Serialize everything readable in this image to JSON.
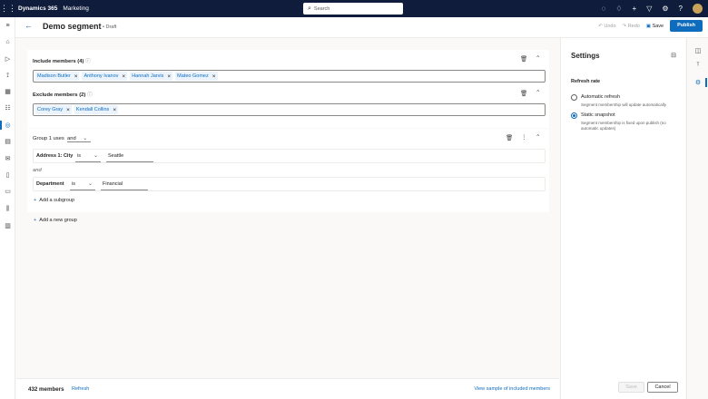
{
  "topbar": {
    "brand": "Dynamics 365",
    "app": "Marketing",
    "search_placeholder": "Search"
  },
  "header": {
    "title": "Demo segment",
    "status": "Draft",
    "undo_label": "Undo",
    "redo_label": "Redo",
    "save_label": "Save",
    "publish_label": "Publish"
  },
  "include": {
    "label": "Include members (4)",
    "members": [
      "Madison Butler",
      "Anthony Ivanov",
      "Hannah Jarvis",
      "Mateo Gomez"
    ]
  },
  "exclude": {
    "label": "Exclude members (2)",
    "members": [
      "Corey Gray",
      "Kendall Collins"
    ]
  },
  "group": {
    "label": "Group 1 uses",
    "operator": "and",
    "conditions": [
      {
        "attribute": "Address 1: City",
        "operator": "is",
        "value": "Seattle"
      },
      {
        "attribute": "Department",
        "operator": "is",
        "value": "Financial"
      }
    ],
    "joiner": "and",
    "add_subgroup_label": "Add a subgroup"
  },
  "add_group_label": "Add a new group",
  "footer": {
    "count": "432 members",
    "refresh_label": "Refresh",
    "sample_link": "View sample of included members"
  },
  "settings": {
    "title": "Settings",
    "refresh_rate_label": "Refresh rate",
    "options": [
      {
        "label": "Automatic refresh",
        "desc": "Segment membership will update automatically",
        "selected": false
      },
      {
        "label": "Static snapshot",
        "desc": "Segment membership is fixed upon publish (no automatic updates)",
        "selected": true
      }
    ],
    "save_label": "Save",
    "cancel_label": "Cancel"
  },
  "user_initials": "RM",
  "colors": {
    "accent": "#0f6cbd",
    "topbar": "#0f1c3b",
    "chip_bg": "#ebf3fc"
  }
}
